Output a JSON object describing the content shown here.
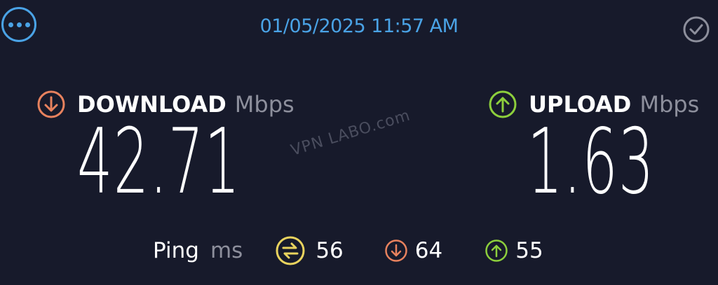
{
  "header": {
    "timestamp": "01/05/2025 11:57 AM",
    "menu_icon": "more-horizontal-icon",
    "status_icon": "check-circle-icon"
  },
  "download": {
    "label": "DOWNLOAD",
    "unit": "Mbps",
    "value": "42.71",
    "icon": "arrow-down-circle-icon",
    "color": "#e8825e"
  },
  "upload": {
    "label": "UPLOAD",
    "unit": "Mbps",
    "value": "1.63",
    "icon": "arrow-up-circle-icon",
    "color": "#8dcf3c"
  },
  "watermark": "VPN LABO.com",
  "ping": {
    "label": "Ping",
    "unit": "ms",
    "idle": {
      "value": "56",
      "icon": "jitter-icon",
      "color": "#e9d35e"
    },
    "download": {
      "value": "64",
      "icon": "arrow-down-circle-icon",
      "color": "#e8825e"
    },
    "upload": {
      "value": "55",
      "icon": "arrow-up-circle-icon",
      "color": "#8dcf3c"
    }
  }
}
